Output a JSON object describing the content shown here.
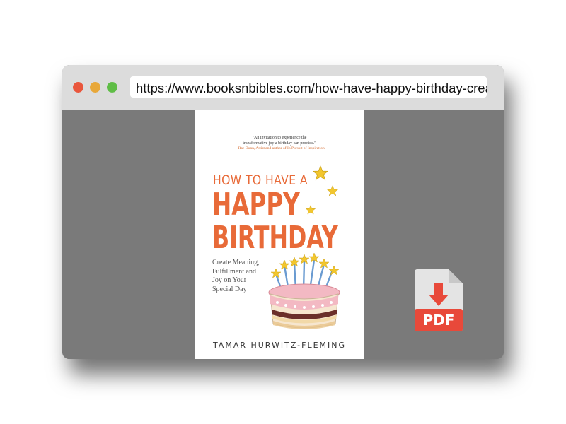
{
  "browser": {
    "url": "https://www.booksnbibles.com/how-have-happy-birthday-crea"
  },
  "book": {
    "blurb_quote_line1": "\"An invitation to experience the",
    "blurb_quote_line2": "transformative joy a birthday can provide.\"",
    "blurb_attribution": "—Rae Dunn, Artist and author of In Pursuit of Inspiration",
    "title_line1": "HOW TO HAVE A",
    "title_line2": "HAPPY",
    "title_line3": "BIRTHDAY",
    "subtitle_line1": "Create Meaning,",
    "subtitle_line2": "Fulfillment and",
    "subtitle_line3": "Joy on Your",
    "subtitle_line4": "Special Day",
    "author": "TAMAR HURWITZ-FLEMING"
  },
  "pdf_icon": {
    "label": "PDF",
    "color": "#e8493a"
  },
  "colors": {
    "title_orange": "#e86a38",
    "star_yellow": "#f2c62e"
  }
}
